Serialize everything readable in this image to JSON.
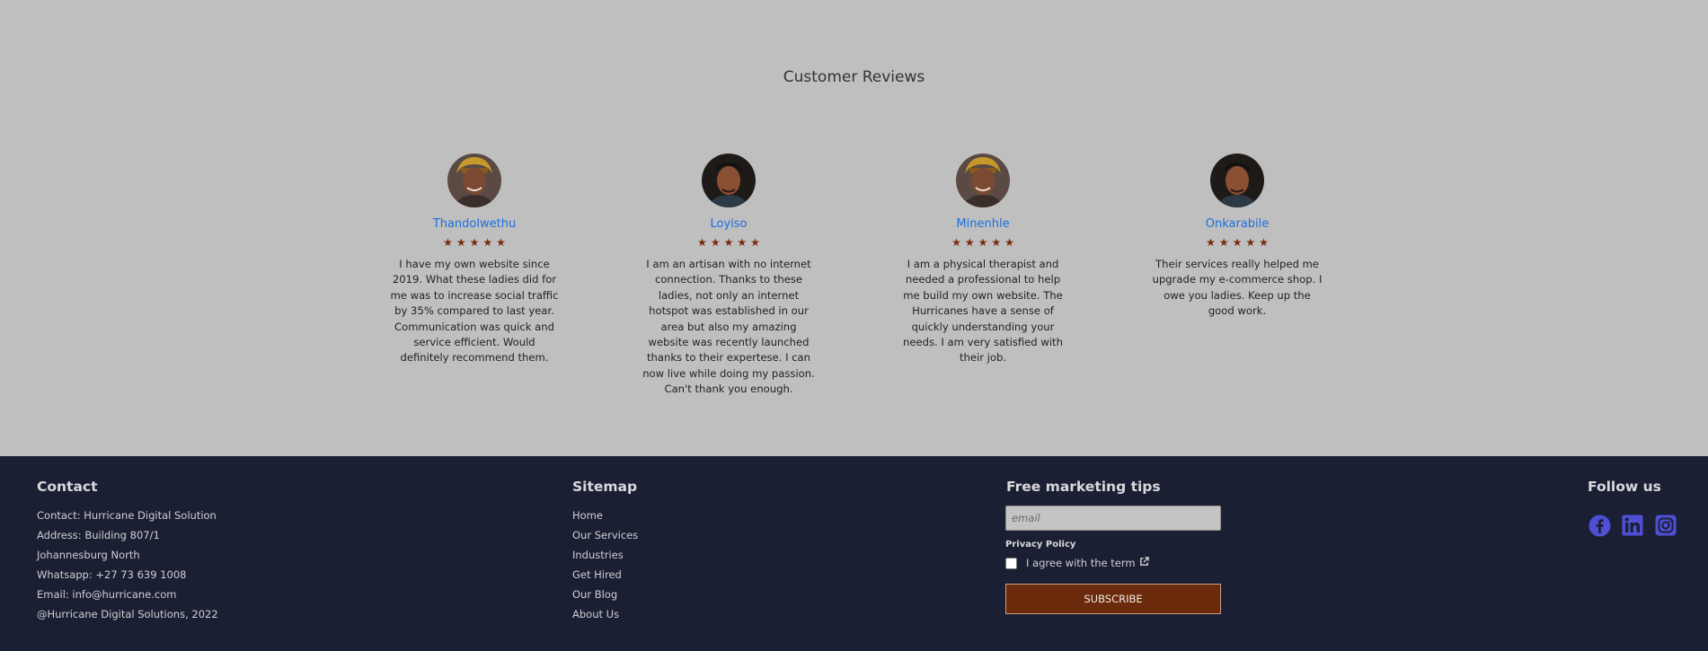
{
  "reviews": {
    "title": "Customer Reviews",
    "items": [
      {
        "name": "Thandolwethu",
        "stars": "★★★★★",
        "text": "I have my own website since 2019. What these ladies did for me was to increase social traffic by 35% compared to last year. Communication was quick and service efficient. Would definitely recommend them."
      },
      {
        "name": "Loyiso",
        "stars": "★★★★★",
        "text": "I am an artisan with no internet connection. Thanks to these ladies, not only an internet hotspot was established in our area but also my amazing website was recently launched thanks to their expertese. I can now live while doing my passion. Can't thank you enough."
      },
      {
        "name": "Minenhle",
        "stars": "★★★★★",
        "text": "I am a physical therapist and needed a professional to help me build my own website. The Hurricanes have a sense of quickly understanding your needs. I am very satisfied with their job."
      },
      {
        "name": "Onkarabile",
        "stars": "★★★★★",
        "text": "Their services really helped me upgrade my e-commerce shop. I owe you ladies. Keep up the good work."
      }
    ]
  },
  "footer": {
    "contact": {
      "heading": "Contact",
      "lines": [
        "Contact: Hurricane Digital Solution",
        "Address: Building 807/1",
        "Johannesburg North",
        "Whatsapp: +27 73 639 1008",
        "Email: info@hurricane.com",
        "@Hurricane Digital Solutions, 2022"
      ]
    },
    "sitemap": {
      "heading": "Sitemap",
      "links": [
        "Home",
        "Our Services",
        "Industries",
        "Get Hired",
        "Our Blog",
        "About Us"
      ]
    },
    "newsletter": {
      "heading": "Free marketing tips",
      "email_placeholder": "email",
      "policy_label": "Privacy Policy",
      "agree_label": "I agree with the term",
      "subscribe_label": "SUBSCRIBE"
    },
    "follow": {
      "heading": "Follow us",
      "icons": [
        "facebook-icon",
        "linkedin-icon",
        "instagram-icon"
      ],
      "icon_color": "#4f4fd6"
    }
  },
  "colors": {
    "reviews_bg": "#bfbfbf",
    "footer_bg": "#1b1f33",
    "reviewer_name": "#1d6fe0",
    "stars": "#7a2a0c",
    "subscribe_bg": "#6b2a0c"
  }
}
